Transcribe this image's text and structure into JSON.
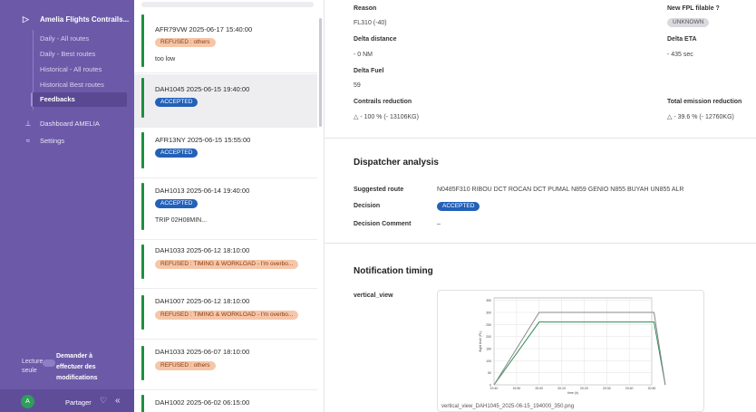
{
  "sidebar": {
    "header_label": "Amelia Flights  Contrails...",
    "sub_items": [
      {
        "label": "Daily - All routes"
      },
      {
        "label": "Daily - Best routes"
      },
      {
        "label": "Historical - All routes"
      },
      {
        "label": "Historical   Best routes"
      }
    ],
    "active_item": "Feedbacks",
    "dashboard_label": "Dashboard AMELIA",
    "settings_label": "Settings",
    "lecture_label": "Lecture seule",
    "demander_label": "Demander à effectuer des modifications",
    "avatar_letter": "A",
    "share_label": "Partager",
    "collapse_glyph": "«"
  },
  "list": {
    "cards": [
      {
        "title": "AFR79VW 2025-06-17 15:40:00",
        "status": "REFUSED : others",
        "status_type": "refused",
        "note": "too low"
      },
      {
        "title": "DAH1045 2025-06-15 19:40:00",
        "status": "ACCEPTED",
        "status_type": "accepted",
        "note": ""
      },
      {
        "title": "AFR13NY 2025-06-15 15:55:00",
        "status": "ACCEPTED",
        "status_type": "accepted",
        "note": ""
      },
      {
        "title": "DAH1013 2025-06-14 19:40:00",
        "status": "ACCEPTED",
        "status_type": "accepted",
        "note": "TRIP 02H08MIN..."
      },
      {
        "title": "DAH1033 2025-06-12 18:10:00",
        "status": "REFUSED : TIMING & WORKLOAD - I'm overbo...",
        "status_type": "refused",
        "note": ""
      },
      {
        "title": "DAH1007 2025-06-12 18:10:00",
        "status": "REFUSED : TIMING & WORKLOAD - I'm overbo...",
        "status_type": "refused",
        "note": ""
      },
      {
        "title": "DAH1033 2025-06-07 18:10:00",
        "status": "REFUSED : others",
        "status_type": "refused",
        "note": ""
      },
      {
        "title": "DAH1002 2025-06-02 06:15:00",
        "status": "",
        "status_type": "",
        "note": ""
      }
    ]
  },
  "detail": {
    "reason_label": "Reason",
    "reason_value": "FL310 (-40)",
    "fpl_label": "New FPL filable ?",
    "fpl_value": "UNKNOWN",
    "delta_distance_label": "Delta distance",
    "delta_distance_value": "- 0 NM",
    "delta_eta_label": "Delta ETA",
    "delta_eta_value": "- 435 sec",
    "delta_fuel_label": "Delta Fuel",
    "delta_fuel_value": "59",
    "contrails_label": "Contrails reduction",
    "contrails_value": "- 100 % (- 13106KG)",
    "total_emission_label": "Total emission reduction",
    "total_emission_value": "- 39.6 % (- 12760KG)",
    "dispatcher_title": "Dispatcher analysis",
    "suggested_route_label": "Suggested route",
    "suggested_route_value": "N0485F310 RIBOU DCT ROCAN DCT PUMAL N859 GENIO N855 BUYAH UN855 ALR",
    "decision_label": "Decision",
    "decision_value": "ACCEPTED",
    "decision_comment_label": "Decision Comment",
    "decision_comment_value": "–",
    "notification_title": "Notification timing",
    "vertical_view_label": "vertical_view",
    "image_caption": "vertical_view_DAH1045_2025-06-15_194000_350.png"
  },
  "colors": {
    "sidebar_bg": "#6c5aa8",
    "accent_blue": "#2361b8",
    "refused_bg": "#f6c6a8",
    "status_green": "#1e8f3e"
  },
  "chart_data": {
    "type": "line",
    "title": "",
    "xlabel": "time (h)",
    "ylabel": "flight level (FL)",
    "x": [
      "19:40",
      "19:50",
      "20:00",
      "20:10",
      "20:20",
      "20:30",
      "20:40",
      "20:50"
    ],
    "ylim": [
      0,
      360
    ],
    "yticks": [
      0,
      50,
      100,
      150,
      200,
      250,
      300,
      350
    ],
    "series": [
      {
        "name": "",
        "color": "#2e8b57",
        "points": [
          [
            0,
            0
          ],
          [
            2.0,
            260
          ],
          [
            7.1,
            260
          ],
          [
            7.6,
            0
          ]
        ]
      },
      {
        "name": "",
        "color": "#8a8a8a",
        "points": [
          [
            0,
            0
          ],
          [
            2.0,
            300
          ],
          [
            7.1,
            300
          ],
          [
            7.6,
            0
          ]
        ]
      }
    ]
  }
}
